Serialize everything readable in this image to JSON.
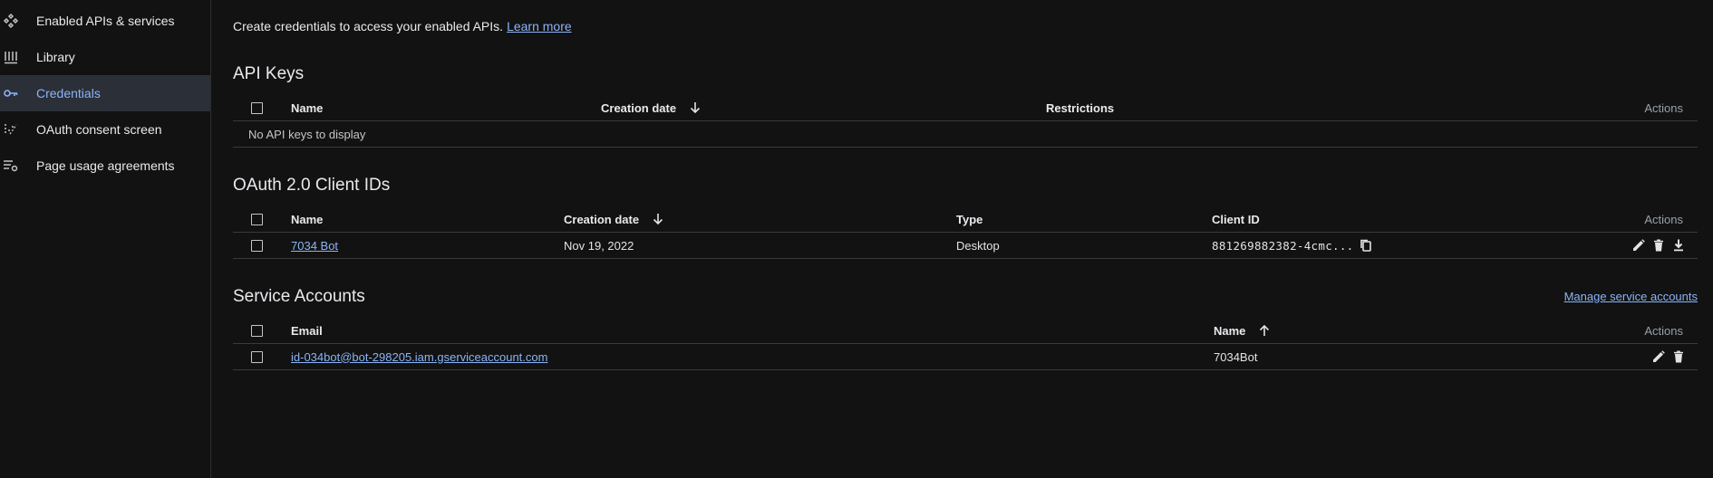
{
  "sidebar": {
    "items": [
      {
        "label": "Enabled APIs & services",
        "icon": "apis-diamond-icon"
      },
      {
        "label": "Library",
        "icon": "library-icon"
      },
      {
        "label": "Credentials",
        "icon": "key-icon",
        "active": true
      },
      {
        "label": "OAuth consent screen",
        "icon": "consent-icon"
      },
      {
        "label": "Page usage agreements",
        "icon": "settings-list-icon"
      }
    ]
  },
  "intro": {
    "text": "Create credentials to access your enabled APIs.",
    "link": "Learn more"
  },
  "api_keys": {
    "title": "API Keys",
    "headers": {
      "name": "Name",
      "creation_date": "Creation date",
      "restrictions": "Restrictions",
      "actions": "Actions"
    },
    "empty": "No API keys to display"
  },
  "oauth": {
    "title": "OAuth 2.0 Client IDs",
    "headers": {
      "name": "Name",
      "creation_date": "Creation date",
      "type": "Type",
      "client_id": "Client ID",
      "actions": "Actions"
    },
    "rows": [
      {
        "name": "7034 Bot",
        "creation_date": "Nov 19, 2022",
        "type": "Desktop",
        "client_id": "881269882382-4cmc..."
      }
    ]
  },
  "service_accounts": {
    "title": "Service Accounts",
    "manage_link": "Manage service accounts",
    "headers": {
      "email": "Email",
      "name": "Name",
      "actions": "Actions"
    },
    "rows": [
      {
        "email": "id-034bot@bot-298205.iam.gserviceaccount.com",
        "name": "7034Bot"
      }
    ]
  },
  "colors": {
    "accent": "#8ab4f8",
    "background": "#121212",
    "active_nav": "#2b2f37"
  }
}
